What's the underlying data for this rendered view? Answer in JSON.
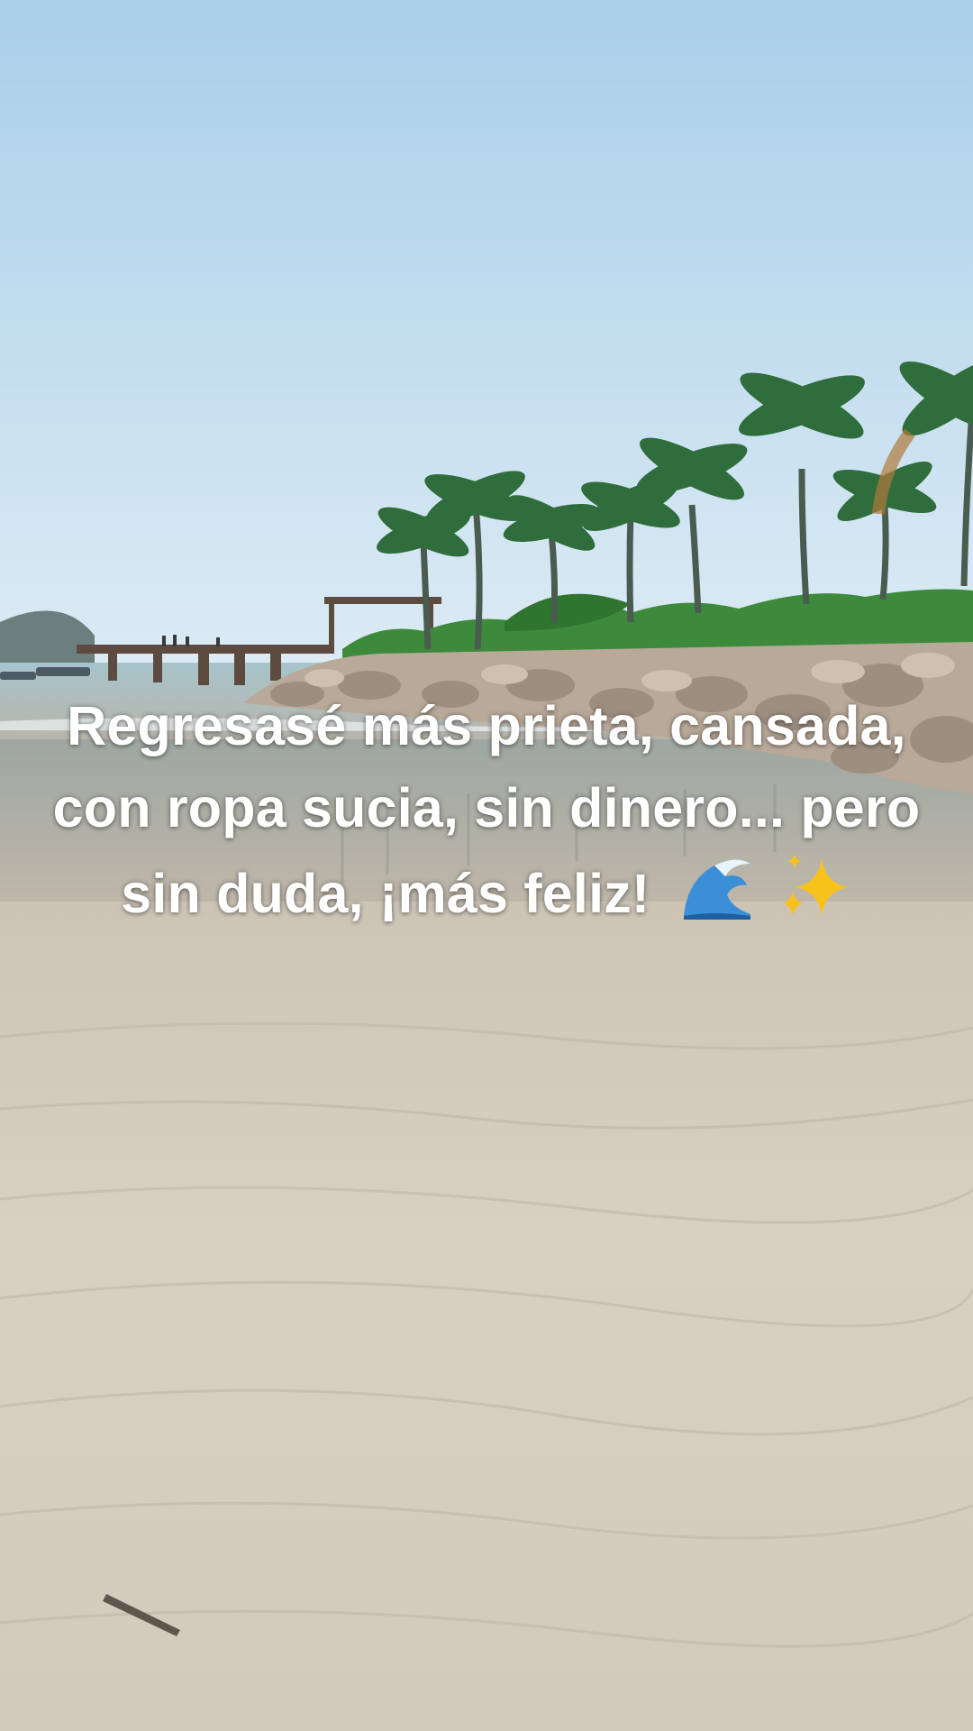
{
  "caption": {
    "text": "Regresasé más prieta, cansada, con ropa sucia, sin dinero... pero sin duda, ¡más feliz!"
  },
  "emojis": [
    "wave-icon",
    "sparkles-icon"
  ],
  "colors": {
    "sky_top": "#a9cfe9",
    "sky_bottom": "#dcebf4",
    "sea": "#9fb9be",
    "sand": "#d6cdbf",
    "palm": "#2f6d3d",
    "rocks": "#b9a999",
    "caption_text": "#ffffff"
  }
}
